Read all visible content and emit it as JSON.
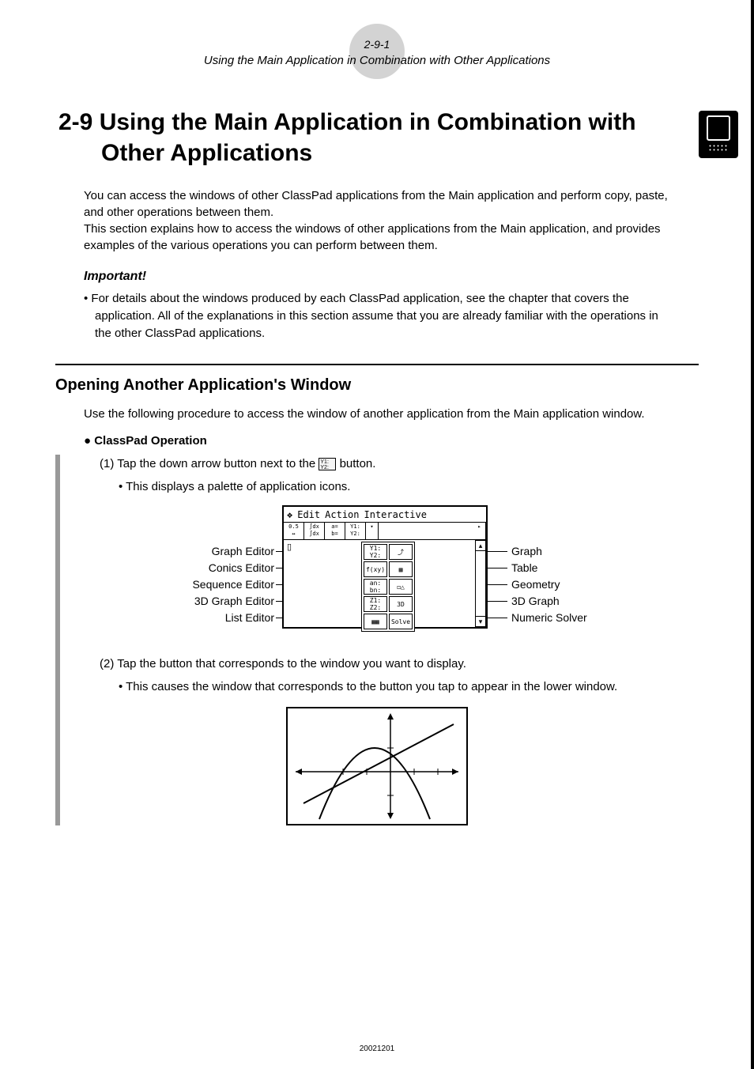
{
  "header": {
    "page_ref": "2-9-1",
    "subtitle": "Using the Main Application in Combination with Other Applications"
  },
  "title": "2-9 Using the Main Application in Combination with Other Applications",
  "intro": "You can access the windows of other ClassPad applications from the Main application and perform copy, paste, and other operations between them.\nThis section explains how to access the windows of other applications from the Main application, and provides examples of the various operations you can perform between them.",
  "important_label": "Important!",
  "important_text": "• For details about the windows produced by each ClassPad application, see the chapter that covers the application. All of the explanations in this section assume that you are already familiar with the operations in the other ClassPad applications.",
  "section_heading": "Opening Another Application's Window",
  "section_intro": "Use the following procedure to access the window of another application from the Main application window.",
  "classpad_op": "● ClassPad Operation",
  "step1_prefix": "(1) Tap the down arrow button next to the ",
  "step1_suffix": " button.",
  "step1_sub": "• This displays a palette of application icons.",
  "menu": {
    "edit": "Edit",
    "action": "Action",
    "interactive": "Interactive"
  },
  "palette_labels_left": {
    "graph_editor": "Graph Editor",
    "conics_editor": "Conics Editor",
    "sequence_editor": "Sequence Editor",
    "3d_graph_editor": "3D Graph Editor",
    "list_editor": "List Editor"
  },
  "palette_labels_right": {
    "graph": "Graph",
    "table": "Table",
    "geometry": "Geometry",
    "3d_graph": "3D Graph",
    "numeric_solver": "Numeric Solver"
  },
  "palette_cells": {
    "r1c1": "Y1:\nY2:",
    "r1c2": "⤴",
    "r2c1": "f(xy)",
    "r2c2": "▦",
    "r3c1": "an:\nbn:",
    "r3c2": "◻△",
    "r4c1": "Z1:\nZ2:",
    "r4c2": "3D",
    "r5c1": "▦▦",
    "r5c2": "Solve"
  },
  "step2": "(2) Tap the button that corresponds to the window you want to display.",
  "step2_sub": "• This causes the window that corresponds to the button you tap to appear in the lower window.",
  "footer": "20021201"
}
